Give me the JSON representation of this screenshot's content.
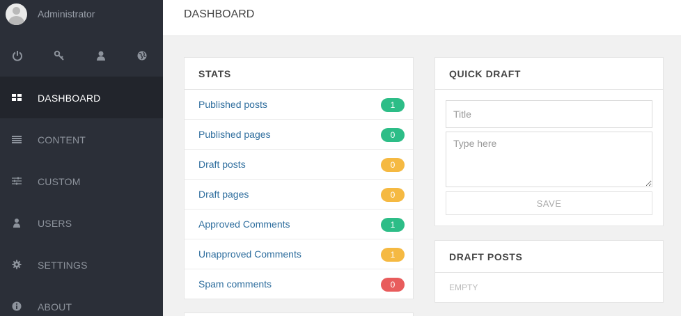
{
  "user": {
    "name": "Administrator"
  },
  "quick_icons": [
    "power-icon",
    "key-icon",
    "user-icon",
    "globe-icon"
  ],
  "nav": [
    {
      "label": "DASHBOARD",
      "icon": "dashboard-icon"
    },
    {
      "label": "CONTENT",
      "icon": "list-icon"
    },
    {
      "label": "CUSTOM",
      "icon": "sliders-icon"
    },
    {
      "label": "USERS",
      "icon": "user-icon"
    },
    {
      "label": "SETTINGS",
      "icon": "gear-icon"
    },
    {
      "label": "ABOUT",
      "icon": "info-icon"
    }
  ],
  "header": {
    "title": "DASHBOARD"
  },
  "stats": {
    "title": "STATS",
    "rows": [
      {
        "label": "Published posts",
        "count": "1",
        "color": "#2dbd87"
      },
      {
        "label": "Published pages",
        "count": "0",
        "color": "#2dbd87"
      },
      {
        "label": "Draft posts",
        "count": "0",
        "color": "#f5b942"
      },
      {
        "label": "Draft pages",
        "count": "0",
        "color": "#f5b942"
      },
      {
        "label": "Approved Comments",
        "count": "1",
        "color": "#2dbd87"
      },
      {
        "label": "Unapproved Comments",
        "count": "1",
        "color": "#f5b942"
      },
      {
        "label": "Spam comments",
        "count": "0",
        "color": "#e85c5c"
      }
    ]
  },
  "quick_draft": {
    "title": "QUICK DRAFT",
    "title_placeholder": "Title",
    "body_placeholder": "Type here",
    "save_label": "SAVE"
  },
  "draft_posts": {
    "title": "DRAFT POSTS",
    "empty_label": "EMPTY"
  },
  "colors": {
    "sidebar": "#2b2f38",
    "sidebar_active": "#22252c",
    "link": "#2f6e9e",
    "badge_green": "#2dbd87",
    "badge_yellow": "#f5b942",
    "badge_red": "#e85c5c"
  }
}
